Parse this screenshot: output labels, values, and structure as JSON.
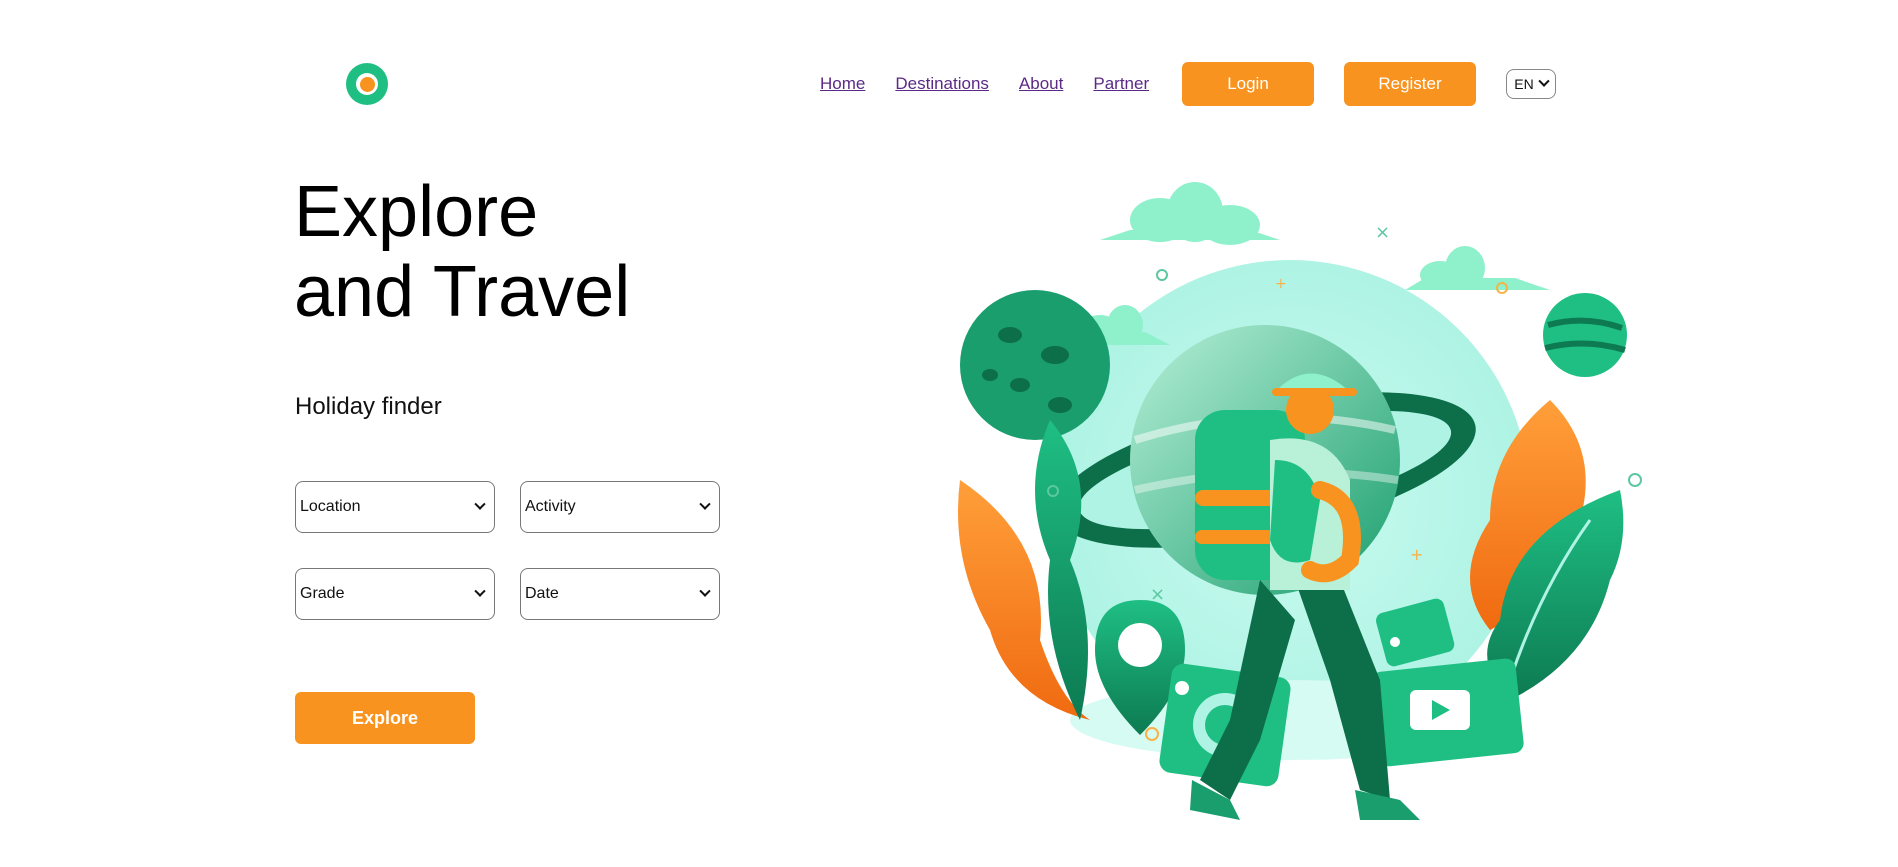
{
  "header": {
    "nav": [
      "Home",
      "Destinations",
      "About",
      "Partner"
    ],
    "login_label": "Login",
    "register_label": "Register",
    "language": "EN"
  },
  "hero": {
    "title_line1": "Explore",
    "title_line2": "and Travel",
    "finder_title": "Holiday finder",
    "selects": {
      "location": "Location",
      "activity": "Activity",
      "grade": "Grade",
      "date": "Date"
    },
    "explore_label": "Explore"
  },
  "colors": {
    "accent_orange": "#f7931e",
    "brand_green": "#1fbf84",
    "link_purple": "#5b2a86"
  },
  "icons": {
    "logo": "logo-icon",
    "chevron": "chevron-down-icon",
    "illustration": "traveler-illustration"
  }
}
